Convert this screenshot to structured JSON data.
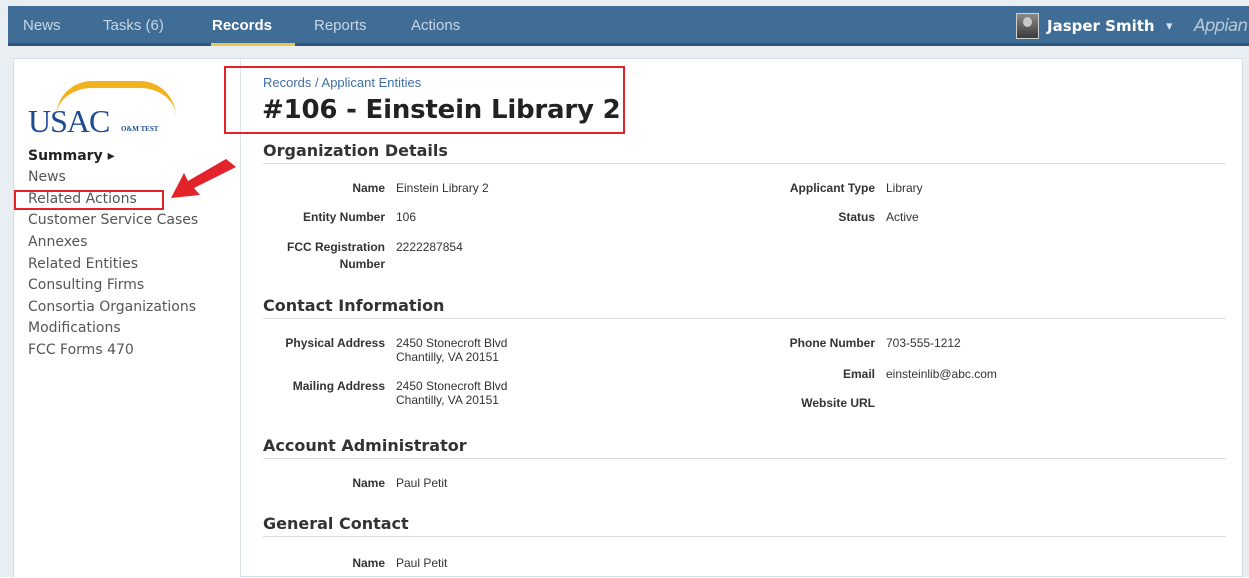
{
  "nav": {
    "tabs": [
      "News",
      "Tasks (6)",
      "Records",
      "Reports",
      "Actions"
    ],
    "active": "Records",
    "user_name": "Jasper Smith",
    "user_caret": "▾",
    "brand": "Appian"
  },
  "sidebar": {
    "logo_text": "USAC",
    "logo_sub": "O&M TEST",
    "items": [
      "Summary ▸",
      "News",
      "Related Actions",
      "Customer Service Cases",
      "Annexes",
      "Related Entities",
      "Consulting Firms",
      "Consortia Organizations",
      "Modifications",
      "FCC Forms 470"
    ]
  },
  "header": {
    "breadcrumb": "Records / Applicant Entities",
    "title": "#106 - Einstein Library 2"
  },
  "org_details": {
    "heading": "Organization Details",
    "name_label": "Name",
    "name_value": "Einstein Library 2",
    "entity_label": "Entity Number",
    "entity_value": "106",
    "fcc_label_1": "FCC Registration",
    "fcc_label_2": "Number",
    "fcc_value": "2222287854",
    "type_label": "Applicant Type",
    "type_value": "Library",
    "status_label": "Status",
    "status_value": "Active"
  },
  "contact": {
    "heading": "Contact Information",
    "physical_label": "Physical Address",
    "physical_line1": "2450 Stonecroft Blvd",
    "physical_line2": "Chantilly, VA 20151",
    "mailing_label": "Mailing Address",
    "mailing_line1": "2450 Stonecroft Blvd",
    "mailing_line2": "Chantilly, VA 20151",
    "phone_label": "Phone Number",
    "phone_value": "703-555-1212",
    "email_label": "Email",
    "email_value": "einsteinlib@abc.com",
    "website_label": "Website URL"
  },
  "account_admin": {
    "heading": "Account Administrator",
    "name_label": "Name",
    "name_value": "Paul Petit"
  },
  "general_contact": {
    "heading": "General Contact",
    "name_label": "Name",
    "name_value": "Paul Petit"
  },
  "colors": {
    "nav_bg": "#3f6d96",
    "accent_underline": "#e7c84a",
    "annotation_red": "#e2232a",
    "link_blue": "#3f6fa6"
  }
}
